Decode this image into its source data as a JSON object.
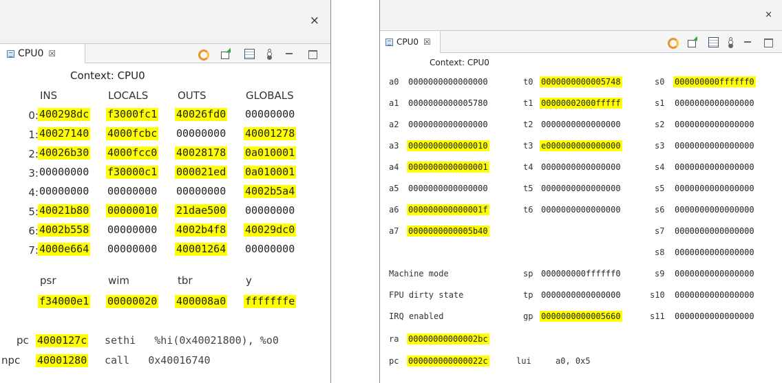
{
  "window1": {
    "close_icon": "×",
    "tab_label": "CPU0",
    "tab_close": "☒",
    "context": "Context: CPU0",
    "col_headers": [
      "INS",
      "LOCALS",
      "OUTS",
      "GLOBALS"
    ],
    "rows": [
      {
        "label": "0:",
        "ins": "400298dc",
        "locals": "f3000fc1",
        "outs": "40026fd0",
        "globals": "00000000"
      },
      {
        "label": "1:",
        "ins": "40027140",
        "locals": "4000fcbc",
        "outs": "00000000",
        "globals": "40001278"
      },
      {
        "label": "2:",
        "ins": "40026b30",
        "locals": "4000fcc0",
        "outs": "40028178",
        "globals": "0a010001"
      },
      {
        "label": "3:",
        "ins": "00000000",
        "locals": "f30000c1",
        "outs": "000021ed",
        "globals": "0a010001"
      },
      {
        "label": "4:",
        "ins": "00000000",
        "locals": "00000000",
        "outs": "00000000",
        "globals": "4002b5a4"
      },
      {
        "label": "5:",
        "ins": "40021b80",
        "locals": "00000010",
        "outs": "21dae500",
        "globals": "00000000"
      },
      {
        "label": "6:",
        "ins": "4002b558",
        "locals": "00000000",
        "outs": "4002b4f8",
        "globals": "40029dc0"
      },
      {
        "label": "7:",
        "ins": "4000e664",
        "locals": "00000000",
        "outs": "40001264",
        "globals": "00000000"
      }
    ],
    "special_headers": [
      "psr",
      "wim",
      "tbr",
      "y"
    ],
    "special_values": [
      "f34000e1",
      "00000020",
      "400008a0",
      "fffffffe"
    ],
    "pc_label": "pc",
    "pc_value": "4000127c",
    "pc_instr": "sethi   %hi(0x40021800), %o0",
    "npc_label": "npc",
    "npc_value": "40001280",
    "npc_instr": "call   0x40016740"
  },
  "window2": {
    "close_icon": "×",
    "tab_label": "CPU0",
    "tab_close": "☒",
    "context": "Context: CPU0",
    "col_a": [
      {
        "name": "a0",
        "value": "0000000000000000"
      },
      {
        "name": "a1",
        "value": "0000000000005780"
      },
      {
        "name": "a2",
        "value": "0000000000000000"
      },
      {
        "name": "a3",
        "value": "0000000000000010"
      },
      {
        "name": "a4",
        "value": "0000000000000001"
      },
      {
        "name": "a5",
        "value": "0000000000000000"
      },
      {
        "name": "a6",
        "value": "000000000000001f"
      },
      {
        "name": "a7",
        "value": "0000000000005b40"
      }
    ],
    "col_t": [
      {
        "name": "t0",
        "value": "0000000000005748"
      },
      {
        "name": "t1",
        "value": "00000002000fffff"
      },
      {
        "name": "t2",
        "value": "0000000000000000"
      },
      {
        "name": "t3",
        "value": "e000000000000000"
      },
      {
        "name": "t4",
        "value": "0000000000000000"
      },
      {
        "name": "t5",
        "value": "0000000000000000"
      },
      {
        "name": "t6",
        "value": "0000000000000000"
      }
    ],
    "col_s": [
      {
        "name": "s0",
        "value": "000000000ffffff0"
      },
      {
        "name": "s1",
        "value": "0000000000000000"
      },
      {
        "name": "s2",
        "value": "0000000000000000"
      },
      {
        "name": "s3",
        "value": "0000000000000000"
      },
      {
        "name": "s4",
        "value": "0000000000000000"
      },
      {
        "name": "s5",
        "value": "0000000000000000"
      },
      {
        "name": "s6",
        "value": "0000000000000000"
      },
      {
        "name": "s7",
        "value": "0000000000000000"
      },
      {
        "name": "s8",
        "value": "0000000000000000"
      },
      {
        "name": "s9",
        "value": "0000000000000000"
      },
      {
        "name": "s10",
        "value": "0000000000000000"
      },
      {
        "name": "s11",
        "value": "0000000000000000"
      }
    ],
    "status_labels": [
      "Machine mode",
      "FPU dirty state",
      "IRQ enabled"
    ],
    "special": [
      {
        "name": "sp",
        "value": "000000000ffffff0"
      },
      {
        "name": "tp",
        "value": "0000000000000000"
      },
      {
        "name": "gp",
        "value": "0000000000005660"
      }
    ],
    "ra_label": "ra",
    "ra_value": "00000000000002bc",
    "pc_label": "pc",
    "pc_value": "000000000000022c",
    "pc_instr": "lui",
    "pc_operands": "a0, 0x5"
  },
  "highlight_color": "#ffff00",
  "icons": [
    "close-icon",
    "tab-icon",
    "refresh-icon",
    "export-icon",
    "layout-icon",
    "view-menu-icon",
    "minimize-icon",
    "maximize-icon"
  ]
}
